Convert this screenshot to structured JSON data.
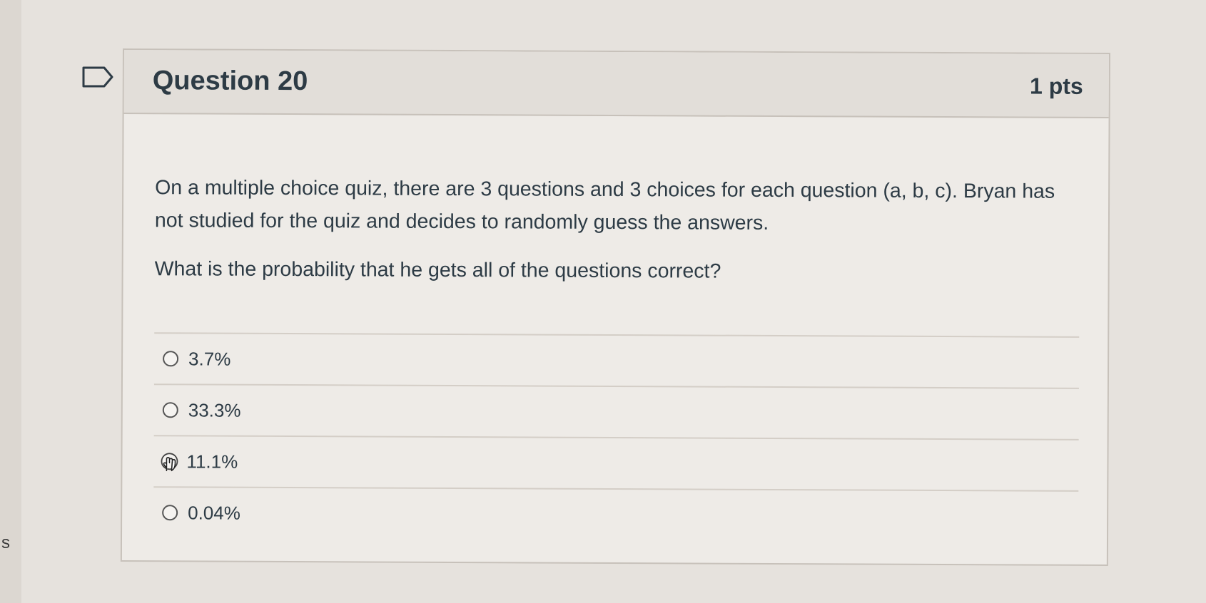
{
  "edge_fragment": "s",
  "question": {
    "title": "Question 20",
    "points": "1 pts",
    "paragraphs": [
      "On a multiple choice quiz, there are 3 questions and 3 choices for each question (a, b, c).  Bryan has not studied for the quiz and decides to randomly guess the answers.",
      "What is the probability that he gets all of the questions correct?"
    ],
    "answers": [
      {
        "label": "3.7%"
      },
      {
        "label": "33.3%"
      },
      {
        "label": "11.1%"
      },
      {
        "label": "0.04%"
      }
    ]
  },
  "icons": {
    "flag": "flag-question-icon",
    "radio": "radio-button-icon",
    "cursor": "hand-pointer-cursor-icon"
  },
  "colors": {
    "page_background": "#e6e2dd",
    "card_header": "#e2ded9",
    "card_body": "#eeebe7",
    "text": "#2d3b45",
    "border": "#c7c1ba"
  }
}
